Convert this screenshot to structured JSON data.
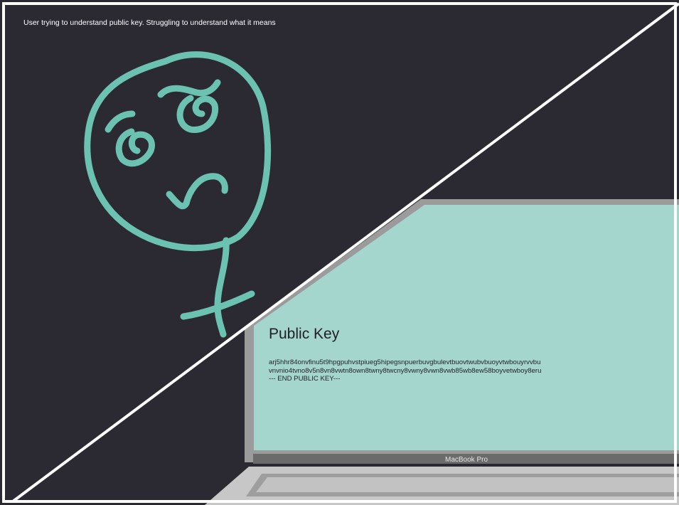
{
  "caption": "User trying to understand public key. Struggling to understand what it means",
  "screen": {
    "title": "Public Key",
    "key_lines": [
      "arj5hhr84onvfinu5t9hpgpuhvstpiueg5hipegsnpuerbuvgbulevtbuovtwubvbuoyvtwbouyrvvbu",
      "vnvnio4tvno8v5n8vn8vwtn8own8twny8twcny8vwny8vwn8vwb85wb8ew58boyvetwboy8eru",
      "--- END PUBLIC KEY---"
    ]
  },
  "laptop": {
    "label": "MacBook Pro"
  },
  "colors": {
    "background": "#2b2a33",
    "stick_figure": "#6cc2b0",
    "screen": "#a5d6cd",
    "laptop_frame": "#9b9b9b",
    "divider": "#ffffff"
  },
  "icons": [
    "confused-stick-figure-icon",
    "laptop-icon"
  ]
}
